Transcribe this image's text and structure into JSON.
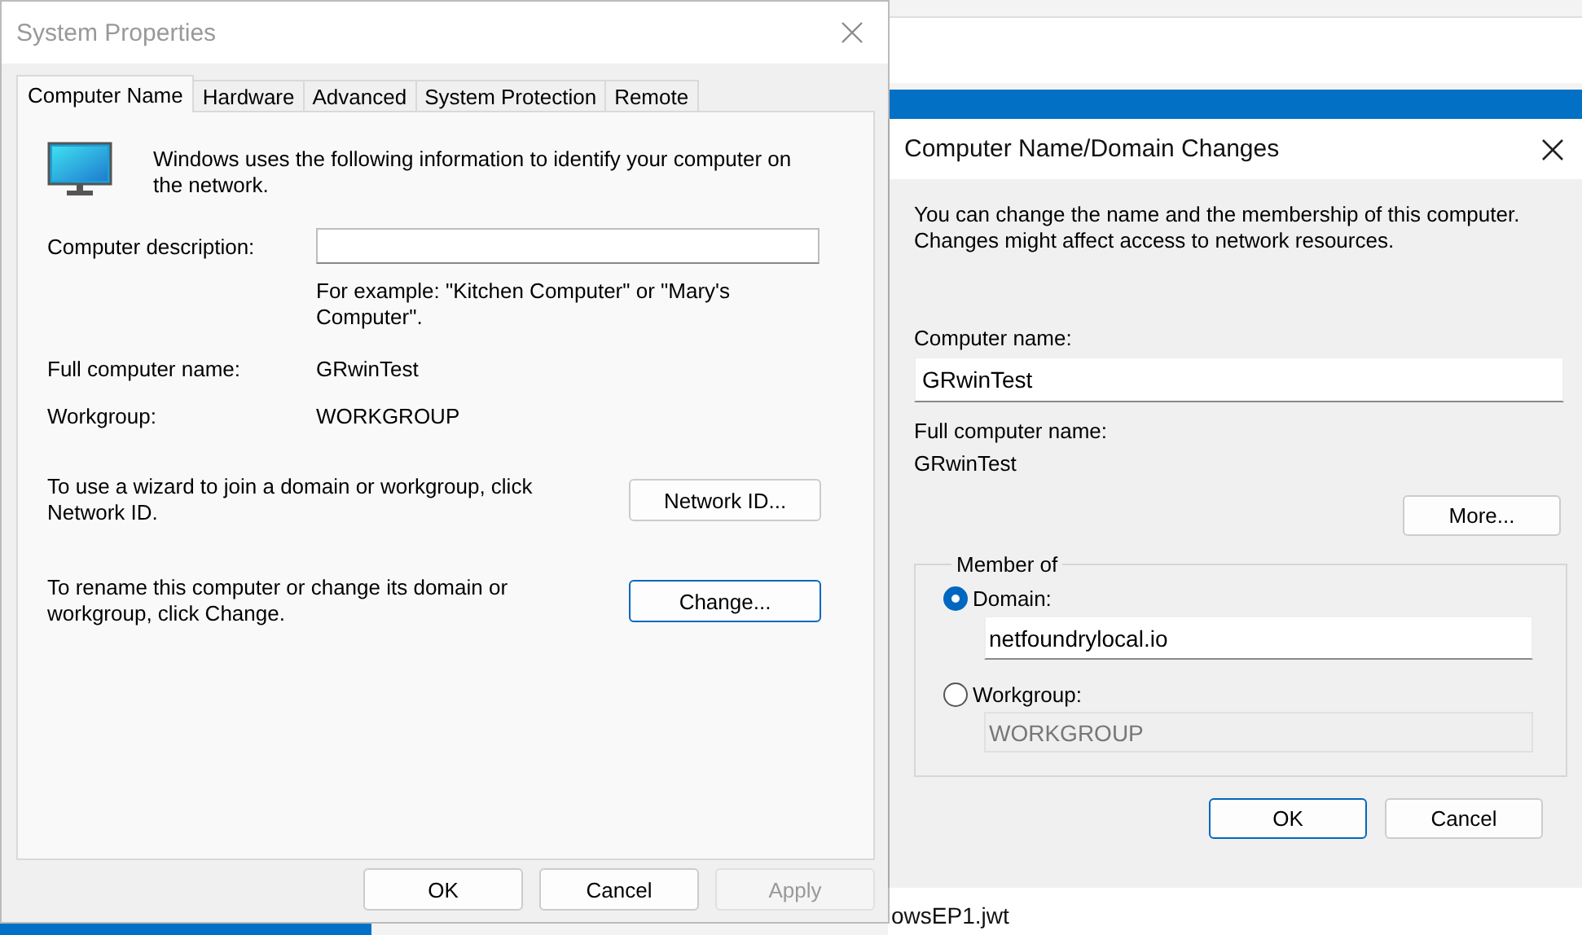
{
  "background": {
    "file_label": "owsEP1.jwt"
  },
  "system_properties": {
    "title": "System Properties",
    "tabs": [
      {
        "label": "Computer Name",
        "selected": true
      },
      {
        "label": "Hardware",
        "selected": false
      },
      {
        "label": "Advanced",
        "selected": false
      },
      {
        "label": "System Protection",
        "selected": false
      },
      {
        "label": "Remote",
        "selected": false
      }
    ],
    "intro": "Windows uses the following information to identify your computer on the network.",
    "description": {
      "label": "Computer description:",
      "hint": "For example: \"Kitchen Computer\" or \"Mary's Computer\"."
    },
    "info_rows": [
      {
        "label": "Full computer name:",
        "value": "GRwinTest"
      },
      {
        "label": "Workgroup:",
        "value": "WORKGROUP"
      }
    ],
    "actions": [
      {
        "text": "To use a wizard to join a domain or workgroup, click Network ID.",
        "button": "Network ID...",
        "focused": false
      },
      {
        "text": "To rename this computer or change its domain or workgroup, click Change.",
        "button": "Change...",
        "focused": true
      }
    ],
    "buttons": [
      {
        "label": "OK",
        "disabled": false
      },
      {
        "label": "Cancel",
        "disabled": false
      },
      {
        "label": "Apply",
        "disabled": true
      }
    ]
  },
  "domain_changes": {
    "title": "Computer Name/Domain Changes",
    "intro": "You can change the name and the membership of this computer. Changes might affect access to network resources.",
    "computer_name": {
      "label": "Computer name:",
      "value": "GRwinTest"
    },
    "full_name": {
      "label": "Full computer name:",
      "value": "GRwinTest"
    },
    "more_button": "More...",
    "member_of": {
      "legend": "Member of",
      "options": [
        {
          "label": "Domain:",
          "selected": true,
          "value": "netfoundrylocal.io"
        },
        {
          "label": "Workgroup:",
          "selected": false,
          "value": "WORKGROUP"
        }
      ]
    },
    "buttons": [
      {
        "label": "OK",
        "default": true
      },
      {
        "label": "Cancel",
        "default": false
      }
    ]
  }
}
